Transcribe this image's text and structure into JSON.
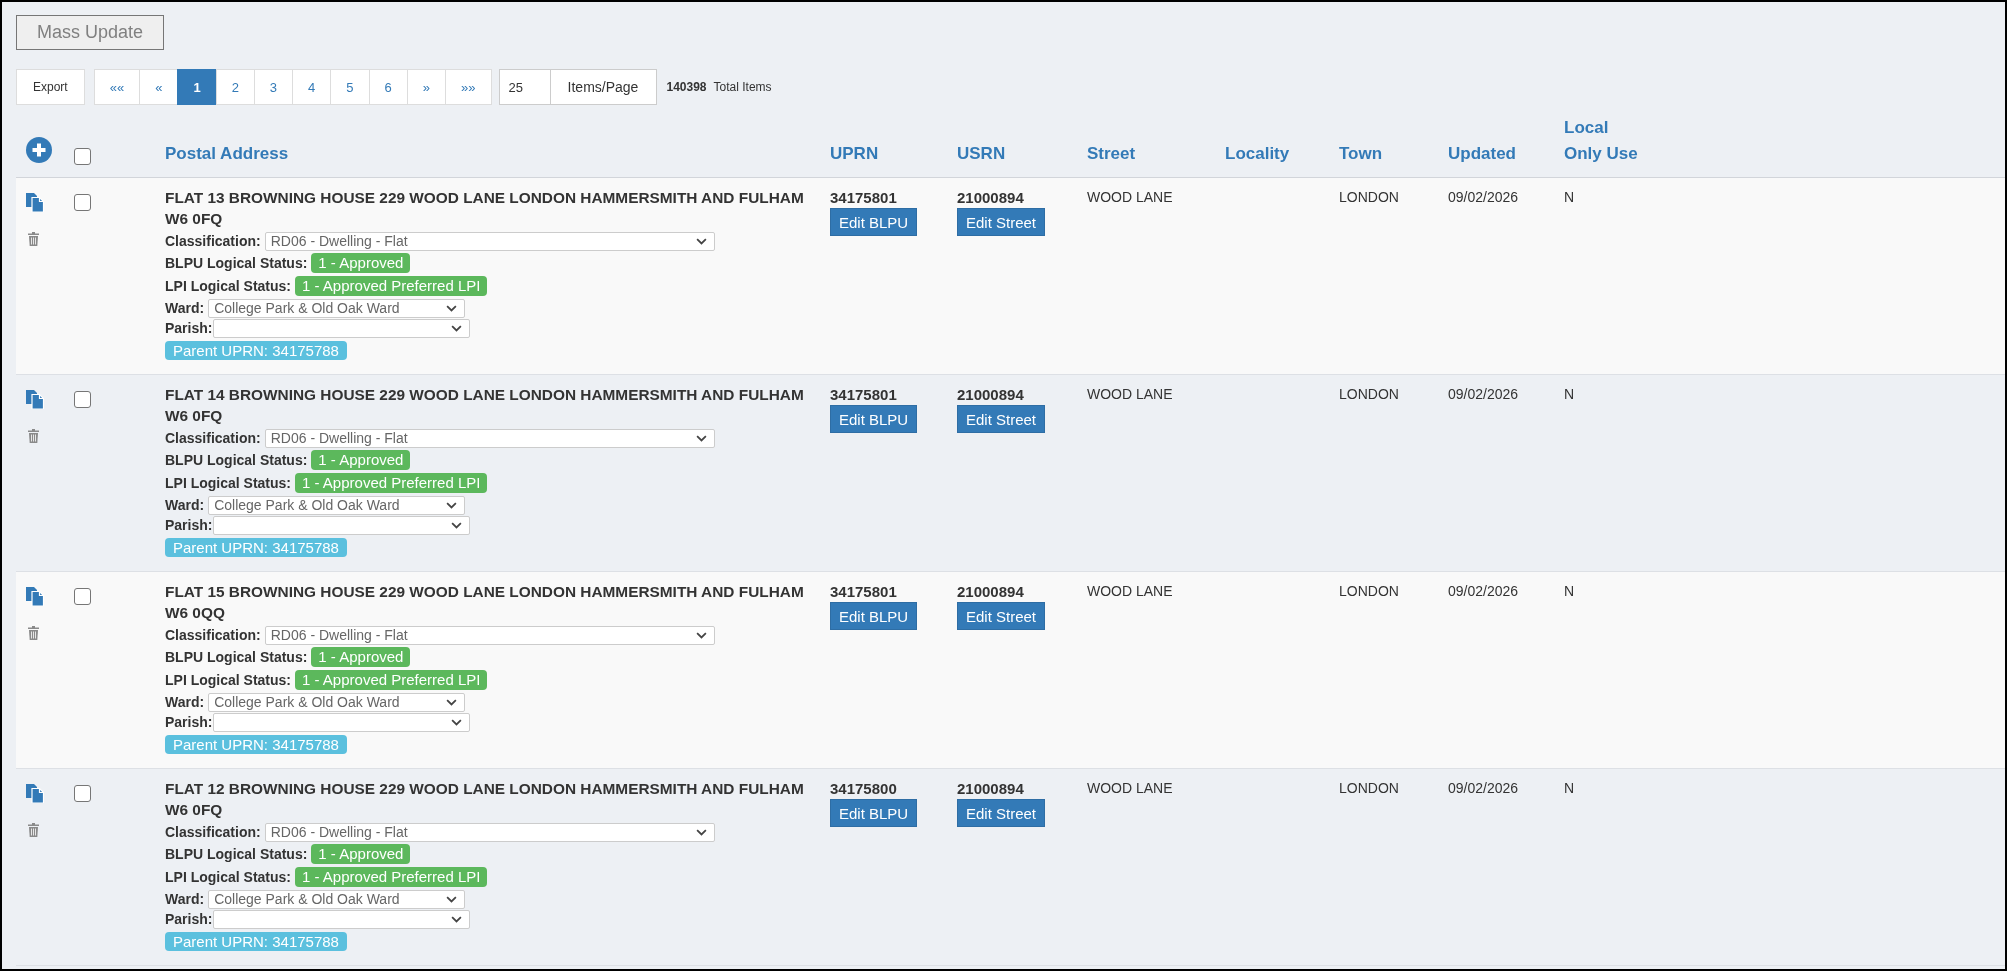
{
  "toolbar": {
    "mass_update": {
      "label": "Mass Update",
      "disabled": true
    },
    "export": "Export"
  },
  "pagination": {
    "pages": [
      {
        "label": "««",
        "selected": false
      },
      {
        "label": "«",
        "selected": false
      },
      {
        "label": "1",
        "selected": true
      },
      {
        "label": "2",
        "selected": false
      },
      {
        "label": "3",
        "selected": false
      },
      {
        "label": "4",
        "selected": false
      },
      {
        "label": "5",
        "selected": false
      },
      {
        "label": "6",
        "selected": false
      },
      {
        "label": "»",
        "selected": false
      },
      {
        "label": "»»",
        "selected": false
      }
    ]
  },
  "page_size": {
    "value": "25",
    "button": "Items/Page"
  },
  "total": {
    "count": "140398",
    "label": "Total Items"
  },
  "table": {
    "select_all": {
      "checked": false
    },
    "columns": [
      "Postal Address",
      "UPRN",
      "USRN",
      "Street",
      "Locality",
      "Town",
      "Updated",
      "Local Only Use"
    ],
    "rows": [
      {
        "checked": false,
        "address": "FLAT 13 BROWNING HOUSE 229 WOOD LANE LONDON HAMMERSMITH AND FULHAM W6 0FQ",
        "classification": {
          "label": "Classification:",
          "value": "RD06 - Dwelling - Flat"
        },
        "blpu_status": {
          "label": "BLPU Logical Status:",
          "value": "1 - Approved"
        },
        "lpi_status": {
          "label": "LPI Logical Status:",
          "value": "1 - Approved Preferred LPI"
        },
        "ward": {
          "label": "Ward:",
          "value": "College Park & Old Oak Ward"
        },
        "parish": {
          "label": "Parish:"
        },
        "parent_uprn": "Parent UPRN: 34175788",
        "uprn": "34175801",
        "edit_blpu": "Edit BLPU",
        "usrn": "21000894",
        "edit_street": "Edit Street",
        "street": "WOOD LANE",
        "town": "LONDON",
        "updated": "09/02/2026",
        "local_only_use": "N"
      },
      {
        "checked": false,
        "address": "FLAT 14 BROWNING HOUSE 229 WOOD LANE LONDON HAMMERSMITH AND FULHAM W6 0FQ",
        "classification": {
          "label": "Classification:",
          "value": "RD06 - Dwelling - Flat"
        },
        "blpu_status": {
          "label": "BLPU Logical Status:",
          "value": "1 - Approved"
        },
        "lpi_status": {
          "label": "LPI Logical Status:",
          "value": "1 - Approved Preferred LPI"
        },
        "ward": {
          "label": "Ward:",
          "value": "College Park & Old Oak Ward"
        },
        "parish": {
          "label": "Parish:"
        },
        "parent_uprn": "Parent UPRN: 34175788",
        "uprn": "34175801",
        "edit_blpu": "Edit BLPU",
        "usrn": "21000894",
        "edit_street": "Edit Street",
        "street": "WOOD LANE",
        "town": "LONDON",
        "updated": "09/02/2026",
        "local_only_use": "N"
      },
      {
        "checked": false,
        "address": "FLAT 15 BROWNING HOUSE 229 WOOD LANE LONDON HAMMERSMITH AND FULHAM W6 0QQ",
        "classification": {
          "label": "Classification:",
          "value": "RD06 - Dwelling - Flat"
        },
        "blpu_status": {
          "label": "BLPU Logical Status:",
          "value": "1 - Approved"
        },
        "lpi_status": {
          "label": "LPI Logical Status:",
          "value": "1 - Approved Preferred LPI"
        },
        "ward": {
          "label": "Ward:",
          "value": "College Park & Old Oak Ward"
        },
        "parish": {
          "label": "Parish:"
        },
        "parent_uprn": "Parent UPRN: 34175788",
        "uprn": "34175801",
        "edit_blpu": "Edit BLPU",
        "usrn": "21000894",
        "edit_street": "Edit Street",
        "street": "WOOD LANE",
        "town": "LONDON",
        "updated": "09/02/2026",
        "local_only_use": "N"
      },
      {
        "checked": false,
        "address": "FLAT 12 BROWNING HOUSE 229 WOOD LANE LONDON HAMMERSMITH AND FULHAM W6 0FQ",
        "classification": {
          "label": "Classification:",
          "value": "RD06 - Dwelling - Flat"
        },
        "blpu_status": {
          "label": "BLPU Logical Status:",
          "value": "1 - Approved"
        },
        "lpi_status": {
          "label": "LPI Logical Status:",
          "value": "1 - Approved Preferred LPI"
        },
        "ward": {
          "label": "Ward:",
          "value": "College Park & Old Oak Ward"
        },
        "parish": {
          "label": "Parish:"
        },
        "parent_uprn": "Parent UPRN: 34175788",
        "uprn": "34175800",
        "edit_blpu": "Edit BLPU",
        "usrn": "21000894",
        "edit_street": "Edit Street",
        "street": "WOOD LANE",
        "town": "LONDON",
        "updated": "09/02/2026",
        "local_only_use": "N"
      }
    ]
  }
}
